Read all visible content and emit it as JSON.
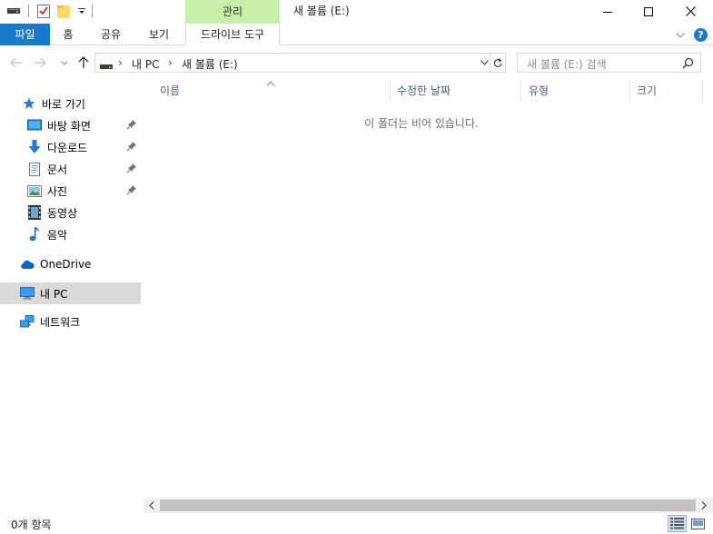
{
  "title_bar": {
    "manage_tab": "관리",
    "window_title": "새 볼륨 (E:)"
  },
  "ribbon": {
    "file_tab": "파일",
    "tabs": [
      "홈",
      "공유",
      "보기"
    ],
    "drive_tools_tab": "드라이브 도구"
  },
  "address": {
    "crumbs": [
      "내 PC",
      "새 볼륨 (E:)"
    ],
    "search_placeholder": "새 볼륨 (E:) 검색"
  },
  "nav_pane": {
    "quick_access": "바로 가기",
    "pinned": [
      "바탕 화면",
      "다운로드",
      "문서",
      "사진"
    ],
    "libraries": [
      "동영상",
      "음악"
    ],
    "onedrive": "OneDrive",
    "this_pc": "내 PC",
    "network": "네트워크"
  },
  "columns": [
    "이름",
    "수정한 날짜",
    "유형",
    "크기"
  ],
  "empty_message": "이 폴더는 비어 있습니다.",
  "status": {
    "item_count": "0개 항목"
  },
  "colors": {
    "accent": "#1979ca",
    "manage_tab": "#c6efa7",
    "selected_nav": "#d9d9d9",
    "column_text": "#4c607a"
  }
}
